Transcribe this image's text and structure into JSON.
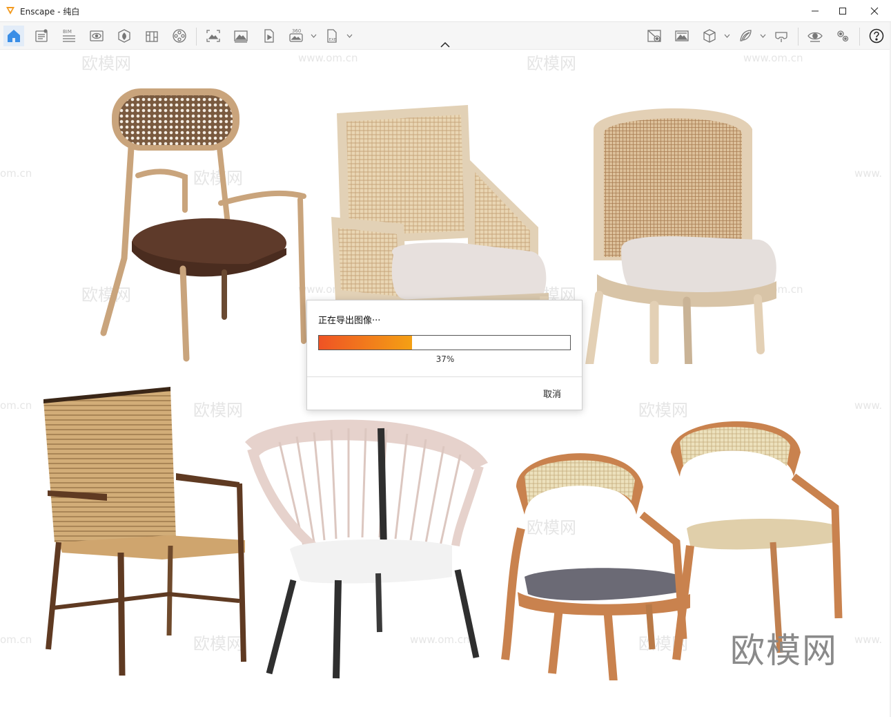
{
  "window": {
    "app_name": "Enscape",
    "separator": " - ",
    "document": "纯白",
    "controls": [
      "minimize",
      "maximize",
      "close"
    ]
  },
  "toolbar": {
    "left_icons": [
      "home-icon",
      "properties-panel-icon",
      "bim-icon",
      "view-icon",
      "asset-library-icon",
      "materials-icon",
      "media-icon",
      "screenshot-icon",
      "batch-render-icon",
      "video-icon",
      "panorama-360-icon",
      "exe-export-icon"
    ],
    "bim_label": "BIM",
    "panorama_label": "360",
    "exe_label": "EXE",
    "right_icons": [
      "no-preview-icon",
      "sync-views-icon",
      "cube-view-icon",
      "feather-icon",
      "vr-headset-icon",
      "visual-settings-icon",
      "settings-icon",
      "help-icon"
    ]
  },
  "watermark": {
    "site_cn": "欧模网",
    "site_url": "www.om.cn",
    "edge_text": "om.cn",
    "edge_right": "www.",
    "brand_text": "欧模网"
  },
  "scene": {
    "chairs": [
      {
        "name": "rattan-back-armchair",
        "colors": {
          "frame": "#c9a47c",
          "seat": "#5e3a2a",
          "cane": "#8b6a4b"
        }
      },
      {
        "name": "cane-box-armchair",
        "colors": {
          "frame": "#e2d1b6",
          "seat": "#e7e0dd",
          "cane": "#d6b98d"
        }
      },
      {
        "name": "cane-barrel-chair",
        "colors": {
          "frame": "#e3d0b5",
          "seat": "#e5dfdc",
          "cane": "#c9a27b"
        }
      },
      {
        "name": "rope-armchair",
        "colors": {
          "frame": "#5f3a22",
          "seat": "#cfa56e",
          "rope": "#d2ad78"
        }
      },
      {
        "name": "rope-tub-chair",
        "colors": {
          "frame": "#2f2f2f",
          "seat": "#f2f2f2",
          "rope": "#e6d2cc"
        }
      },
      {
        "name": "bentwood-cane-chairs-pair",
        "colors": {
          "frame": "#c9824e",
          "seat_left": "#6b6a75",
          "seat_right": "#e0cfaa",
          "cane": "#e3d4aa"
        }
      }
    ]
  },
  "export_dialog": {
    "message": "正在导出图像···",
    "progress": 0.37,
    "progress_text": "37%",
    "cancel_label": "取消",
    "progress_colors": {
      "start": "#ef5324",
      "end": "#f4a014"
    }
  }
}
